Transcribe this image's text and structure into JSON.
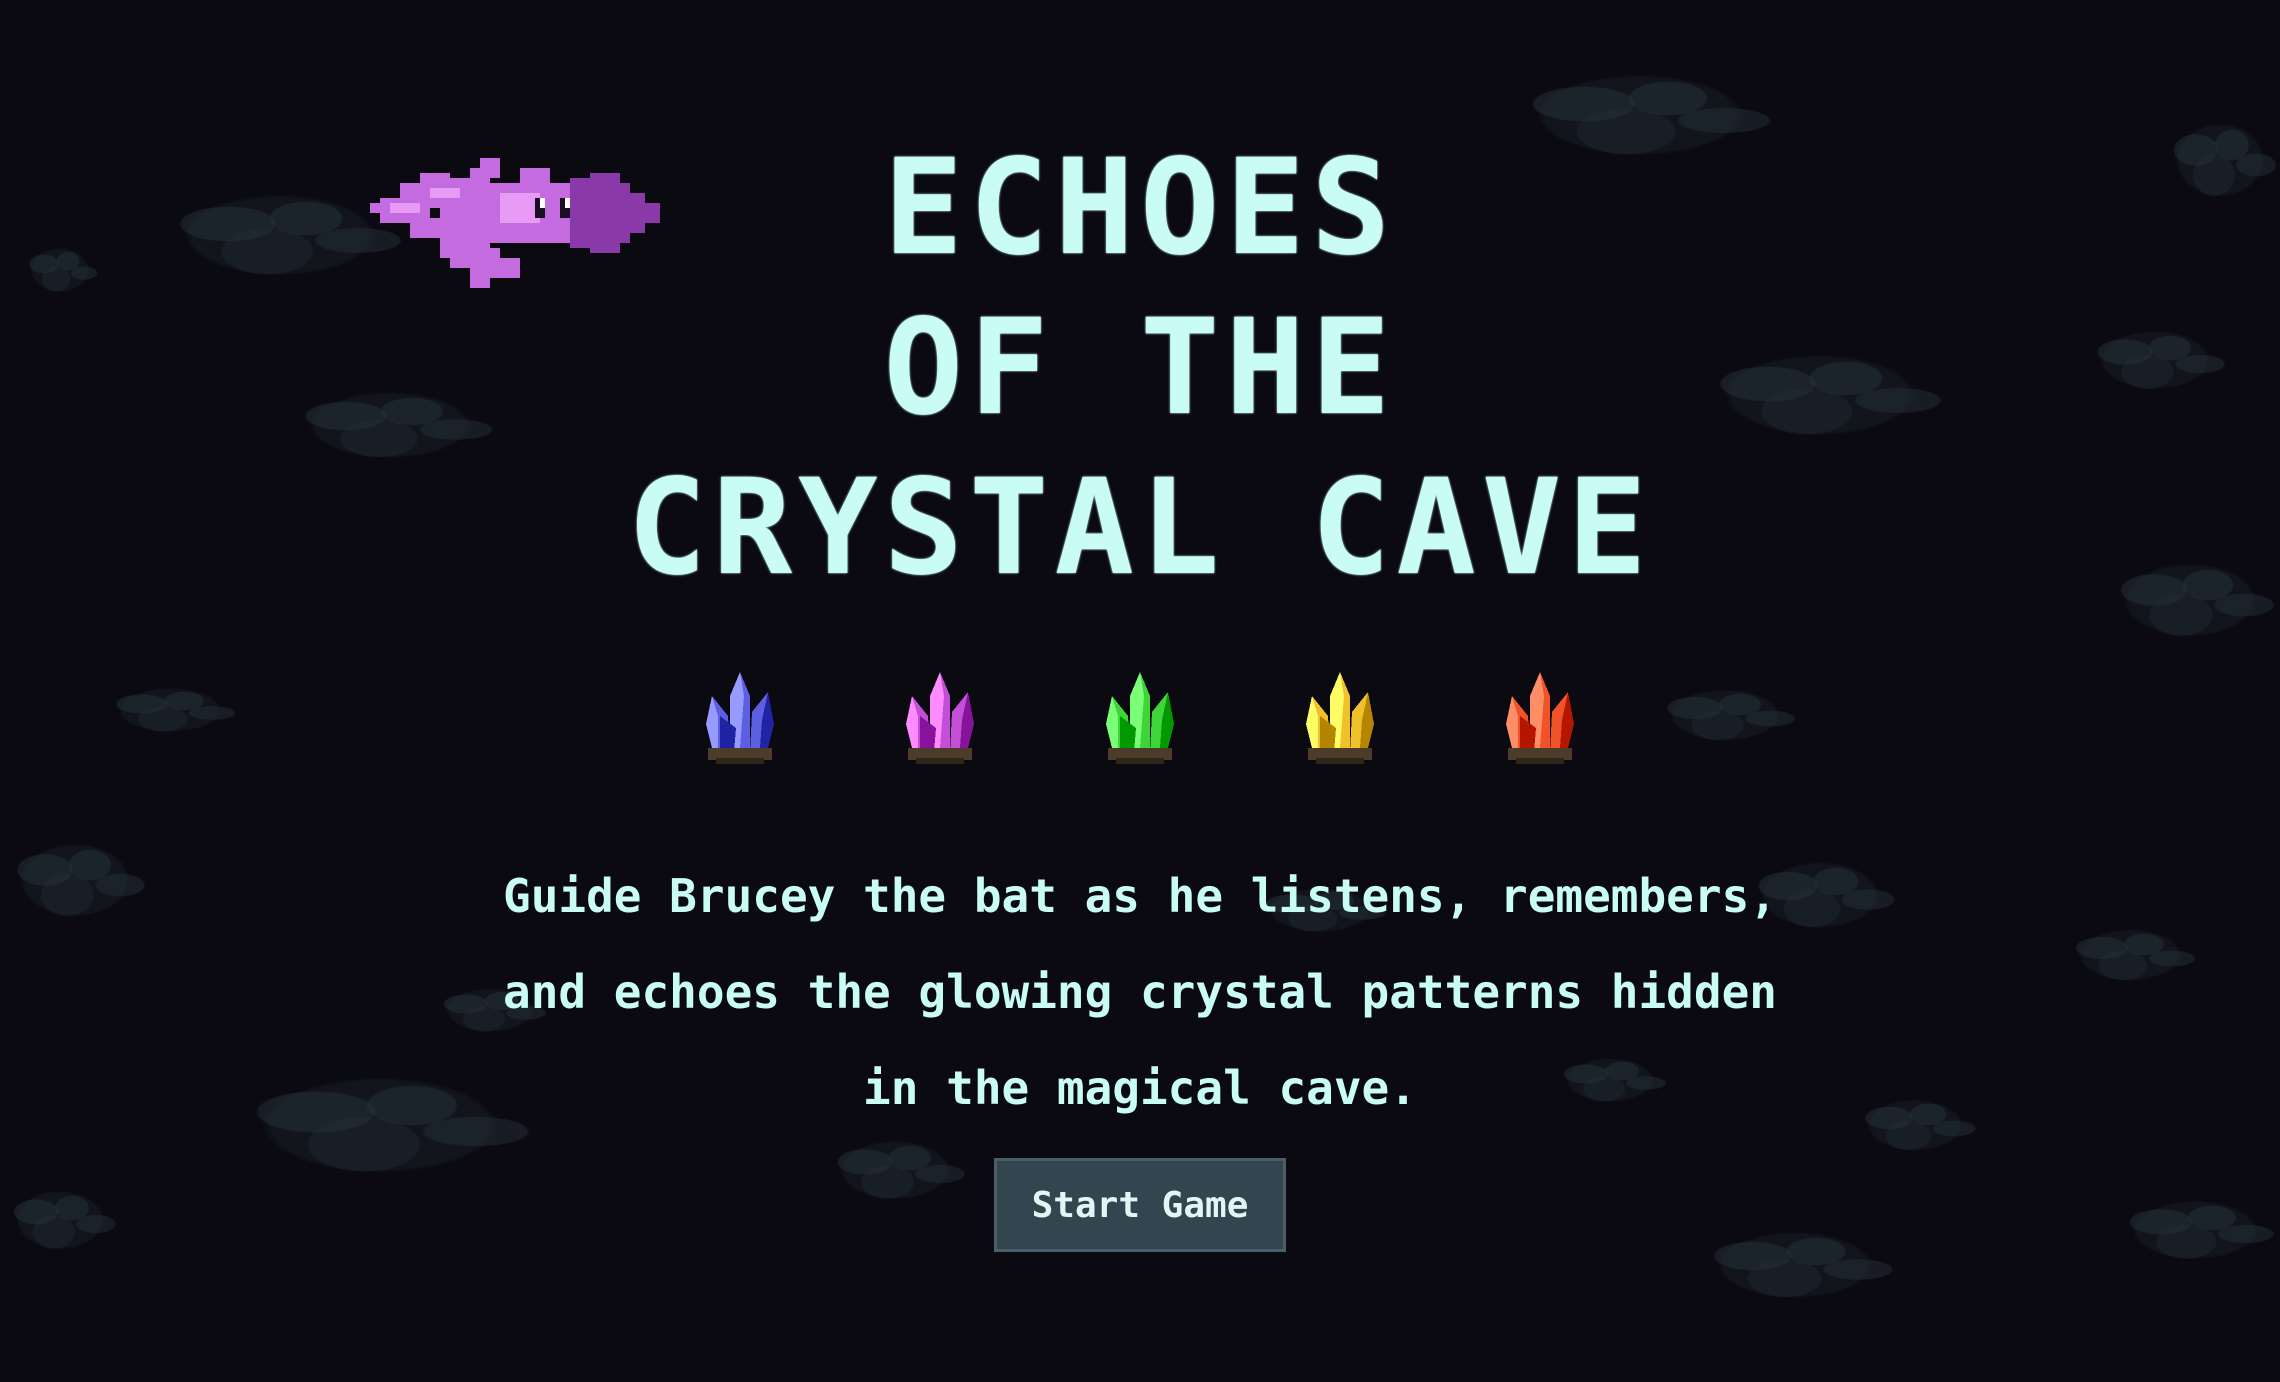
{
  "title": {
    "line1": "ECHOES",
    "line2": "OF THE",
    "line3": "CRYSTAL CAVE"
  },
  "description": "Guide Brucey the bat as he listens, remembers, and echoes the glowing crystal patterns hidden in the magical cave.",
  "start_button": {
    "label": "Start Game"
  },
  "character": {
    "icon": "bat-icon",
    "color": "#c46be0"
  },
  "crystals": [
    {
      "name": "blue-crystal-icon",
      "color": "#5b5fe0"
    },
    {
      "name": "purple-crystal-icon",
      "color": "#c24fd6"
    },
    {
      "name": "green-crystal-icon",
      "color": "#3ed43a"
    },
    {
      "name": "yellow-crystal-icon",
      "color": "#f0c12a"
    },
    {
      "name": "red-crystal-icon",
      "color": "#f0522a"
    }
  ],
  "colors": {
    "background": "#0b0a11",
    "text": "#c9fcf5",
    "button_bg": "#33464f"
  }
}
